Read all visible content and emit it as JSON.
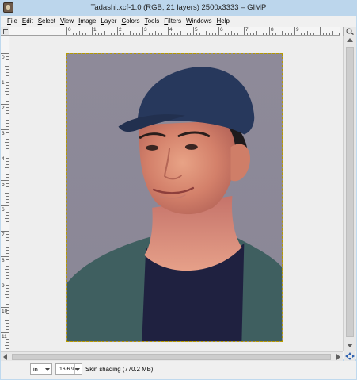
{
  "window": {
    "title": "Tadashi.xcf-1.0 (RGB, 21 layers) 2500x3333 – GIMP"
  },
  "menubar": {
    "items": [
      {
        "underline": "F",
        "rest": "ile"
      },
      {
        "underline": "E",
        "rest": "dit"
      },
      {
        "underline": "S",
        "rest": "elect"
      },
      {
        "underline": "V",
        "rest": "iew"
      },
      {
        "underline": "I",
        "rest": "mage"
      },
      {
        "underline": "L",
        "rest": "ayer"
      },
      {
        "underline": "C",
        "rest": "olors"
      },
      {
        "underline": "T",
        "rest": "ools"
      },
      {
        "underline": "F",
        "rest": "ilters"
      },
      {
        "underline": "W",
        "rest": "indows"
      },
      {
        "underline": "H",
        "rest": "elp"
      }
    ]
  },
  "rulers": {
    "horizontal_labels": [
      "0",
      "1",
      "2",
      "3",
      "4",
      "5",
      "6",
      "7",
      "8",
      "9"
    ],
    "vertical_labels": [
      "0",
      "1",
      "2",
      "3",
      "4",
      "5",
      "6",
      "7",
      "8",
      "9",
      "10",
      "11"
    ]
  },
  "statusbar": {
    "unit": "in",
    "zoom": "16.6 %",
    "status": "Skin shading (770.2 MB)"
  },
  "colors": {
    "canvas_background": "#8f8b9a",
    "selection_border": "#b59a00",
    "cap": "#27385c",
    "shirt": "#1f2140",
    "jacket": "#3f5f60",
    "skin": "#d98a6c"
  },
  "icons": {
    "app": "gimp-icon",
    "ruler_corner": "quick-mask-icon",
    "zoom": "zoom-icon",
    "navigate": "navigate-icon"
  }
}
